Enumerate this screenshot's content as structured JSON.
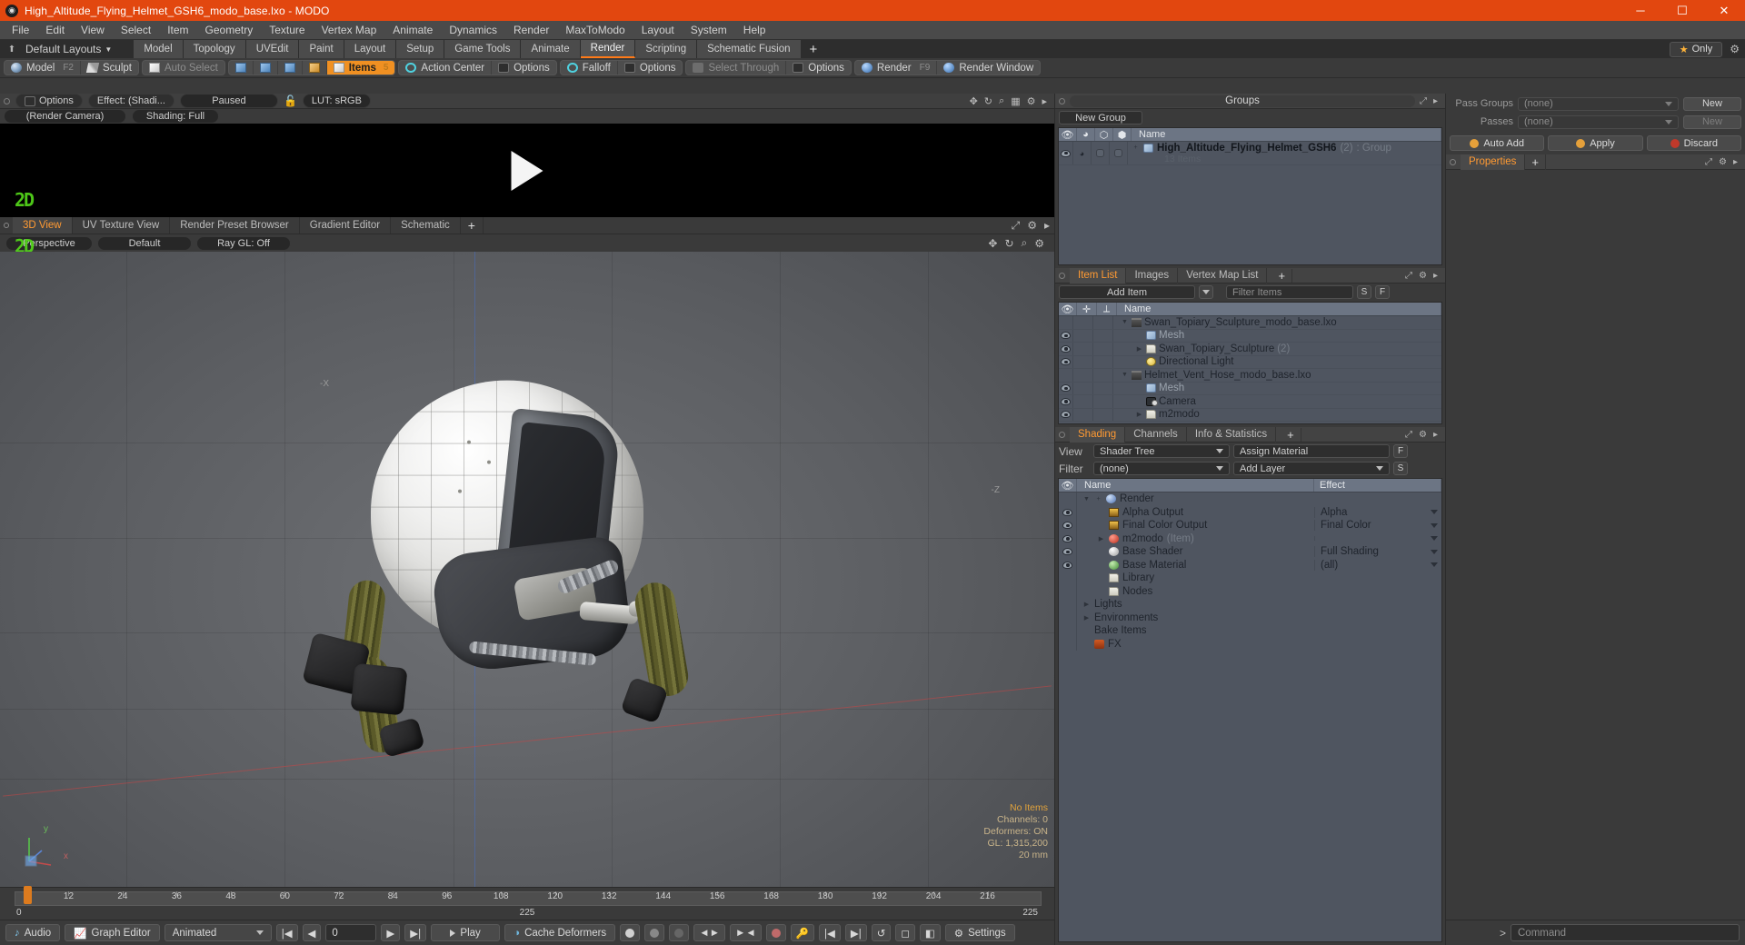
{
  "titlebar": {
    "title": "High_Altitude_Flying_Helmet_GSH6_modo_base.lxo - MODO",
    "app_icon": "modo-icon",
    "minimize": "─",
    "maximize": "☐",
    "close": "✕"
  },
  "menubar": {
    "items": [
      "File",
      "Edit",
      "View",
      "Select",
      "Item",
      "Geometry",
      "Texture",
      "Vertex Map",
      "Animate",
      "Dynamics",
      "Render",
      "MaxToModo",
      "Layout",
      "System",
      "Help"
    ]
  },
  "layoutrow": {
    "default_layouts": "Default Layouts",
    "tabs": [
      {
        "label": "Model",
        "active": false
      },
      {
        "label": "Topology",
        "active": false
      },
      {
        "label": "UVEdit",
        "active": false
      },
      {
        "label": "Paint",
        "active": false
      },
      {
        "label": "Layout",
        "active": false
      },
      {
        "label": "Setup",
        "active": false
      },
      {
        "label": "Game Tools",
        "active": false
      },
      {
        "label": "Animate",
        "active": false
      },
      {
        "label": "Render",
        "active": true
      },
      {
        "label": "Scripting",
        "active": false
      },
      {
        "label": "Schematic Fusion",
        "active": false
      }
    ],
    "add_tab": "+",
    "only_label": "Only",
    "star_icon": "star-icon",
    "gear_icon": "gear-icon"
  },
  "toolbar": {
    "mode_model": "Model",
    "mode_model_key": "F2",
    "mode_sculpt": "Sculpt",
    "auto_select": "Auto Select",
    "selection_modes": [
      "vertices-icon",
      "edges-icon",
      "polygons-icon",
      "materials-icon"
    ],
    "items_label": "Items",
    "items_key": "5",
    "action_center": "Action Center",
    "options_1": "Options",
    "falloff": "Falloff",
    "options_2": "Options",
    "select_through": "Select Through",
    "options_3": "Options",
    "render": "Render",
    "render_key": "F9",
    "render_window": "Render Window"
  },
  "render_preview": {
    "options": "Options",
    "effect": "Effect: (Shadi...",
    "paused": "Paused",
    "lock_icon": "unlock-icon",
    "lut": "LUT: sRGB",
    "camera": "(Render Camera)",
    "shading": "Shading: Full",
    "watermark": "2D",
    "play_icon": "play-triangle-icon",
    "head_icons": [
      "move-icon",
      "rotate-icon",
      "zoom-icon",
      "grid-icon",
      "gear-icon",
      "chevron-right-icon"
    ]
  },
  "viewport": {
    "tabs": [
      {
        "label": "3D View",
        "active": true
      },
      {
        "label": "UV Texture View",
        "active": false
      },
      {
        "label": "Render Preset Browser",
        "active": false
      },
      {
        "label": "Gradient Editor",
        "active": false
      },
      {
        "label": "Schematic",
        "active": false
      }
    ],
    "add_tab": "+",
    "view_mode": "Perspective",
    "shading_style": "Default",
    "raygl": "Ray GL: Off",
    "watermark": "2D",
    "axis_labels": {
      "x": "-X",
      "z": "-Z",
      "y": "y",
      "minor_x": "x"
    },
    "stats": {
      "no_items": "No Items",
      "channels": "Channels: 0",
      "deformers": "Deformers: ON",
      "gl": "GL: 1,315,200",
      "unit": "20 mm"
    }
  },
  "groups_panel": {
    "title": "Groups",
    "new_group": "New Group",
    "columns": [
      "eye-column",
      "camera-column",
      "lock-column",
      "render-column",
      "Name"
    ],
    "rows": [
      {
        "name": "High_Altitude_Flying_Helmet_GSH6",
        "count": "(2)",
        "type": ": Group",
        "sub": "13 Items",
        "expander": "+"
      }
    ]
  },
  "item_list": {
    "tabs": [
      {
        "label": "Item List",
        "active": true
      },
      {
        "label": "Images",
        "active": false
      },
      {
        "label": "Vertex Map List",
        "active": false
      }
    ],
    "add_tab": "+",
    "add_item": "Add Item",
    "filter_placeholder": "Filter Items",
    "btn_s": "S",
    "btn_f": "F",
    "columns": [
      "eye-column",
      "add-column",
      "axis-column",
      "Name"
    ],
    "rows": [
      {
        "name": "Swan_Topiary_Sculpture_modo_base.lxo",
        "icon": "scene-icon",
        "indent": 0,
        "twisty": "▼",
        "eye": false,
        "dim": false
      },
      {
        "name": "Mesh",
        "icon": "mesh-icon",
        "indent": 1,
        "twisty": "",
        "eye": true,
        "dim": true
      },
      {
        "name": "Swan_Topiary_Sculpture",
        "count": "(2)",
        "icon": "folder-icon",
        "indent": 1,
        "twisty": "▶",
        "eye": true,
        "dim": false
      },
      {
        "name": "Directional Light",
        "icon": "light-icon",
        "indent": 1,
        "twisty": "",
        "eye": true,
        "dim": false
      },
      {
        "name": "Helmet_Vent_Hose_modo_base.lxo",
        "icon": "scene-icon",
        "indent": 0,
        "twisty": "▼",
        "eye": false,
        "dim": false
      },
      {
        "name": "Mesh",
        "icon": "mesh-icon",
        "indent": 1,
        "twisty": "",
        "eye": true,
        "dim": true
      },
      {
        "name": "Camera",
        "icon": "camera-icon",
        "indent": 1,
        "twisty": "",
        "eye": true,
        "dim": false
      },
      {
        "name": "m2modo",
        "icon": "folder-icon",
        "indent": 1,
        "twisty": "▶",
        "eye": true,
        "dim": false
      }
    ]
  },
  "shading_panel": {
    "tabs": [
      {
        "label": "Shading",
        "active": true
      },
      {
        "label": "Channels",
        "active": false
      },
      {
        "label": "Info & Statistics",
        "active": false
      }
    ],
    "add_tab": "+",
    "view_label": "View",
    "view_value": "Shader Tree",
    "assign_material": "Assign Material",
    "btn_f": "F",
    "filter_label": "Filter",
    "filter_value": "(none)",
    "add_layer": "Add Layer",
    "btn_s": "S",
    "columns": [
      "eye-column",
      "Name",
      "Effect"
    ],
    "rows": [
      {
        "name": "Render",
        "effect": "",
        "icon": "sphere-blue-icon",
        "indent": 0,
        "twisty": "▼",
        "plus": "+",
        "eye": false,
        "dd": false
      },
      {
        "name": "Alpha Output",
        "effect": "Alpha",
        "icon": "image-icon",
        "indent": 1,
        "twisty": "",
        "eye": true,
        "dd": true
      },
      {
        "name": "Final Color Output",
        "effect": "Final Color",
        "icon": "image-icon",
        "indent": 1,
        "twisty": "",
        "eye": true,
        "dd": true
      },
      {
        "name": "m2modo",
        "note": "(Item)",
        "effect": "",
        "icon": "material-red-icon",
        "indent": 1,
        "twisty": "▶",
        "eye": true,
        "dd": true
      },
      {
        "name": "Base Shader",
        "effect": "Full Shading",
        "icon": "shader-white-icon",
        "indent": 1,
        "twisty": "",
        "eye": true,
        "dd": true
      },
      {
        "name": "Base Material",
        "effect": "(all)",
        "icon": "material-green-icon",
        "indent": 1,
        "twisty": "",
        "eye": true,
        "dd": true
      },
      {
        "name": "Library",
        "effect": "",
        "icon": "folder-icon",
        "indent": 1,
        "twisty": "",
        "eye": false,
        "dd": false
      },
      {
        "name": "Nodes",
        "effect": "",
        "icon": "folder-icon",
        "indent": 1,
        "twisty": "",
        "eye": false,
        "dd": false
      },
      {
        "name": "Lights",
        "effect": "",
        "icon": "",
        "indent": 0,
        "twisty": "▶",
        "eye": false,
        "dd": false
      },
      {
        "name": "Environments",
        "effect": "",
        "icon": "",
        "indent": 0,
        "twisty": "▶",
        "eye": false,
        "dd": false
      },
      {
        "name": "Bake Items",
        "effect": "",
        "icon": "",
        "indent": 0,
        "twisty": "",
        "eye": false,
        "dd": false
      },
      {
        "name": "FX",
        "effect": "",
        "icon": "fx-icon",
        "indent": 0,
        "twisty": "",
        "eye": false,
        "dd": false
      }
    ]
  },
  "right_panel": {
    "pass_groups_label": "Pass Groups",
    "pass_groups_value": "(none)",
    "new_btn_1": "New",
    "passes_label": "Passes",
    "passes_value": "(none)",
    "new_btn_2": "New",
    "auto_add": "Auto Add",
    "apply": "Apply",
    "discard": "Discard",
    "properties_tab": "Properties",
    "add_tab": "+"
  },
  "timeline": {
    "ticks": [
      "12",
      "24",
      "36",
      "48",
      "60",
      "72",
      "84",
      "96",
      "108",
      "120",
      "132",
      "144",
      "156",
      "168",
      "180",
      "192",
      "204",
      "216"
    ],
    "start": "0",
    "end": "225",
    "center": "225",
    "playhead_frame": "0"
  },
  "bottombar": {
    "audio": "Audio",
    "graph_editor": "Graph Editor",
    "animated": "Animated",
    "frame_value": "0",
    "play": "Play",
    "cache_deformers": "Cache Deformers",
    "settings": "Settings",
    "command_placeholder": "Command",
    "command_prompt": ">"
  }
}
